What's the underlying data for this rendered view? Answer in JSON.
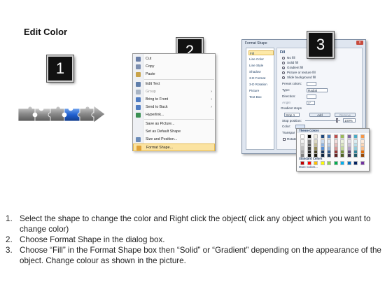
{
  "title": "Edit Color",
  "badges": [
    "1",
    "2",
    "3"
  ],
  "context_menu": {
    "items": [
      {
        "label": "Cut",
        "icon": "scissors-icon",
        "color": "#6a7fa8",
        "disabled": false,
        "submenu": false
      },
      {
        "label": "Copy",
        "icon": "copy-icon",
        "color": "#7d8fb0",
        "disabled": false,
        "submenu": false
      },
      {
        "label": "Paste",
        "icon": "paste-icon",
        "color": "#c9a34a",
        "disabled": false,
        "submenu": false
      },
      {
        "label": "Edit Text",
        "icon": "edit-text-icon",
        "color": "#5f7eab",
        "disabled": false,
        "submenu": false
      },
      {
        "label": "Group",
        "icon": "group-icon",
        "color": "#a8b4c4",
        "disabled": true,
        "submenu": true
      },
      {
        "label": "Bring to Front",
        "icon": "bring-to-front-icon",
        "color": "#4f7cc2",
        "disabled": false,
        "submenu": true
      },
      {
        "label": "Send to Back",
        "icon": "send-to-back-icon",
        "color": "#4f7cc2",
        "disabled": false,
        "submenu": true
      },
      {
        "label": "Hyperlink...",
        "icon": "hyperlink-icon",
        "color": "#3a8f52",
        "disabled": false,
        "submenu": false
      },
      {
        "label": "Save as Picture...",
        "icon": "",
        "color": "",
        "disabled": false,
        "submenu": false
      },
      {
        "label": "Set as Default Shape",
        "icon": "",
        "color": "",
        "disabled": false,
        "submenu": false
      },
      {
        "label": "Size and Position...",
        "icon": "size-position-icon",
        "color": "#6c8cb8",
        "disabled": false,
        "submenu": false
      },
      {
        "label": "Format Shape...",
        "icon": "format-shape-icon",
        "color": "#e0a23a",
        "disabled": false,
        "submenu": false,
        "highlighted": true
      }
    ]
  },
  "dialog": {
    "title": "Format Shape",
    "close_label": "x",
    "nav": [
      "Fill",
      "Line Color",
      "Line Style",
      "Shadow",
      "3-D Format",
      "3-D Rotation",
      "Picture",
      "Text Box"
    ],
    "section": "Fill",
    "fill_options": [
      {
        "label": "No fill",
        "selected": false
      },
      {
        "label": "Solid fill",
        "selected": false
      },
      {
        "label": "Gradient fill",
        "selected": true
      },
      {
        "label": "Picture or texture fill",
        "selected": false
      },
      {
        "label": "Slide background fill",
        "selected": false
      }
    ],
    "preset_colors_label": "Preset colors:",
    "type_label": "Type:",
    "type_value": "Radial",
    "direction_label": "Direction:",
    "angle_label": "Angle:",
    "angle_value": "0°",
    "gradient_stops_label": "Gradient stops",
    "stop_value": "Stop 1",
    "add_label": "Add",
    "remove_label": "Remove",
    "stop_position_label": "Stop position:",
    "stop_position_value": "100%",
    "color_label": "Color:",
    "transparency_label": "Transpar",
    "rotate_label": "Rotate"
  },
  "picker": {
    "theme_header": "Theme Colors",
    "standard_header": "Standard Colors",
    "more_label": "More Colors...",
    "top_row": [
      "#ffffff",
      "#000000",
      "#eeece1",
      "#1f497d",
      "#4f81bd",
      "#c0504d",
      "#9bbb59",
      "#8064a2",
      "#4bacc6",
      "#f79646"
    ],
    "shades": [
      [
        "#f2f2f2",
        "#7f7f7f",
        "#ddd9c3",
        "#c6d9f0",
        "#dbe5f1",
        "#f2dcdb",
        "#ebf1dd",
        "#e5e0ec",
        "#dbeef3",
        "#fdeada"
      ],
      [
        "#d8d8d8",
        "#595959",
        "#c4bd97",
        "#8db3e2",
        "#b8cce4",
        "#e5b9b7",
        "#d7e3bc",
        "#ccc1d9",
        "#b7dde8",
        "#fbd5b5"
      ],
      [
        "#bfbfbf",
        "#3f3f3f",
        "#938953",
        "#548dd4",
        "#95b3d7",
        "#d99694",
        "#c3d69b",
        "#b2a2c7",
        "#92cddc",
        "#fac08f"
      ],
      [
        "#a5a5a5",
        "#262626",
        "#494429",
        "#17365d",
        "#366092",
        "#953734",
        "#76923c",
        "#5f497a",
        "#31859b",
        "#e36c09"
      ],
      [
        "#7f7f7f",
        "#0c0c0c",
        "#1d1b10",
        "#0f243e",
        "#244061",
        "#632423",
        "#4f6128",
        "#3f3151",
        "#205867",
        "#974806"
      ]
    ],
    "standard": [
      "#c00000",
      "#ff0000",
      "#ffc000",
      "#ffff00",
      "#92d050",
      "#00b050",
      "#00b0f0",
      "#0070c0",
      "#002060",
      "#7030a0"
    ]
  },
  "steps": [
    {
      "n": "1.",
      "text": "Select the shape to change the color and Right click the object( click any object which you want to change color)"
    },
    {
      "n": "2.",
      "text": "Choose Format Shape in the dialog box."
    },
    {
      "n": "3.",
      "text": "Choose “Fill” in the Format Shape box then “Solid” or “Gradient” depending on the appearance of the object. Change colour as shown in the picture."
    }
  ]
}
